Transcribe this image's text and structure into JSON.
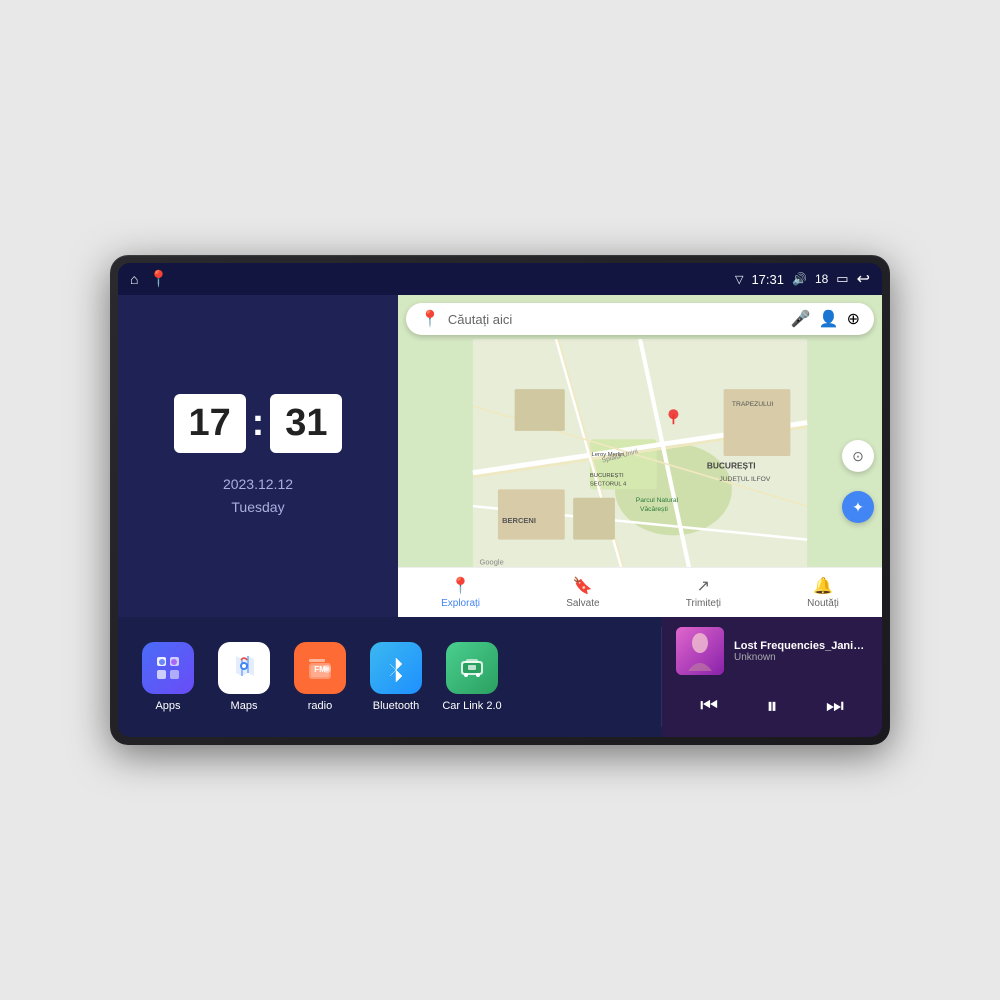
{
  "device": {
    "status_bar": {
      "left_icons": [
        "home",
        "map-pin"
      ],
      "time": "17:31",
      "signal_icon": "▽",
      "volume_icon": "🔊",
      "battery_level": "18",
      "battery_icon": "▭",
      "back_icon": "↩"
    },
    "clock": {
      "hours": "17",
      "minutes": "31",
      "date": "2023.12.12",
      "day": "Tuesday"
    },
    "map": {
      "search_placeholder": "Căutați aici",
      "labels": {
        "berceni": "BERCENI",
        "bucuresti": "BUCUREȘTI",
        "judet": "JUDEȚUL ILFOV",
        "trapezului": "TRAPEZULUI",
        "parcul": "Parcul Natural Văcărești",
        "leroy": "Leroy Merlin",
        "sector4": "BUCUREȘTI\nSECTORUL 4"
      },
      "nav_items": [
        {
          "label": "Explorați",
          "icon": "📍",
          "active": true
        },
        {
          "label": "Salvate",
          "icon": "🔖",
          "active": false
        },
        {
          "label": "Trimiteți",
          "icon": "↗",
          "active": false
        },
        {
          "label": "Noutăți",
          "icon": "🔔",
          "active": false
        }
      ]
    },
    "apps": [
      {
        "id": "apps",
        "label": "Apps",
        "icon": "apps",
        "bg": "blue-purple"
      },
      {
        "id": "maps",
        "label": "Maps",
        "icon": "maps",
        "bg": "white"
      },
      {
        "id": "radio",
        "label": "radio",
        "icon": "radio",
        "bg": "orange"
      },
      {
        "id": "bluetooth",
        "label": "Bluetooth",
        "icon": "bluetooth",
        "bg": "blue"
      },
      {
        "id": "carlink",
        "label": "Car Link 2.0",
        "icon": "carlink",
        "bg": "green"
      }
    ],
    "music": {
      "title": "Lost Frequencies_Janieck Devy-...",
      "artist": "Unknown",
      "controls": {
        "prev": "⏮",
        "play_pause": "⏸",
        "next": "⏭"
      }
    }
  }
}
